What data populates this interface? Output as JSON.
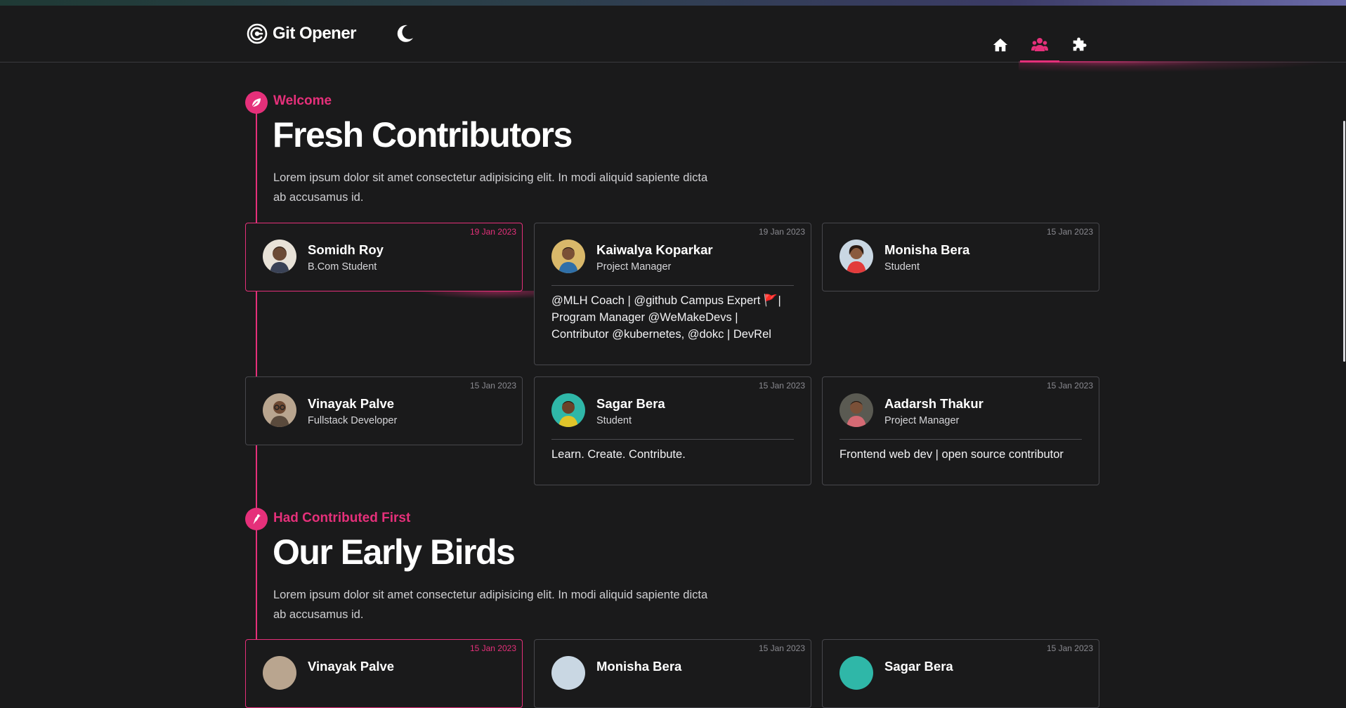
{
  "header": {
    "logo_text": "Git Opener",
    "nav": [
      {
        "icon": "home-icon",
        "active": false
      },
      {
        "icon": "users-icon",
        "active": true
      },
      {
        "icon": "puzzle-icon",
        "active": false
      }
    ]
  },
  "colors": {
    "accent": "#e5307a",
    "background": "#1a1a1b",
    "card_border": "#47474c"
  },
  "sections": [
    {
      "eyebrow": "Welcome",
      "title": "Fresh Contributors",
      "description": "Lorem ipsum dolor sit amet consectetur adipisicing elit. In modi aliquid sapiente dicta ab accusamus id.",
      "cards": [
        {
          "name": "Somidh Roy",
          "role": "B.Com Student",
          "date": "19 Jan 2023",
          "bio": ""
        },
        {
          "name": "Kaiwalya Koparkar",
          "role": "Project Manager",
          "date": "19 Jan 2023",
          "bio": "@MLH Coach | @github Campus Expert 🚩| Program Manager @WeMakeDevs | Contributor @kubernetes, @dokc | DevRel"
        },
        {
          "name": "Monisha Bera",
          "role": "Student",
          "date": "15 Jan 2023",
          "bio": ""
        },
        {
          "name": "Vinayak Palve",
          "role": "Fullstack Developer",
          "date": "15 Jan 2023",
          "bio": ""
        },
        {
          "name": "Sagar Bera",
          "role": "Student",
          "date": "15 Jan 2023",
          "bio": "Learn. Create. Contribute."
        },
        {
          "name": "Aadarsh Thakur",
          "role": "Project Manager",
          "date": "15 Jan 2023",
          "bio": "Frontend web dev | open source contributor"
        }
      ]
    },
    {
      "eyebrow": "Had Contributed First",
      "title": "Our Early Birds",
      "description": "Lorem ipsum dolor sit amet consectetur adipisicing elit. In modi aliquid sapiente dicta ab accusamus id.",
      "cards": [
        {
          "name": "Vinayak Palve",
          "date": "15 Jan 2023"
        },
        {
          "name": "Monisha Bera",
          "date": "15 Jan 2023"
        },
        {
          "name": "Sagar Bera",
          "date": "15 Jan 2023"
        }
      ]
    }
  ]
}
